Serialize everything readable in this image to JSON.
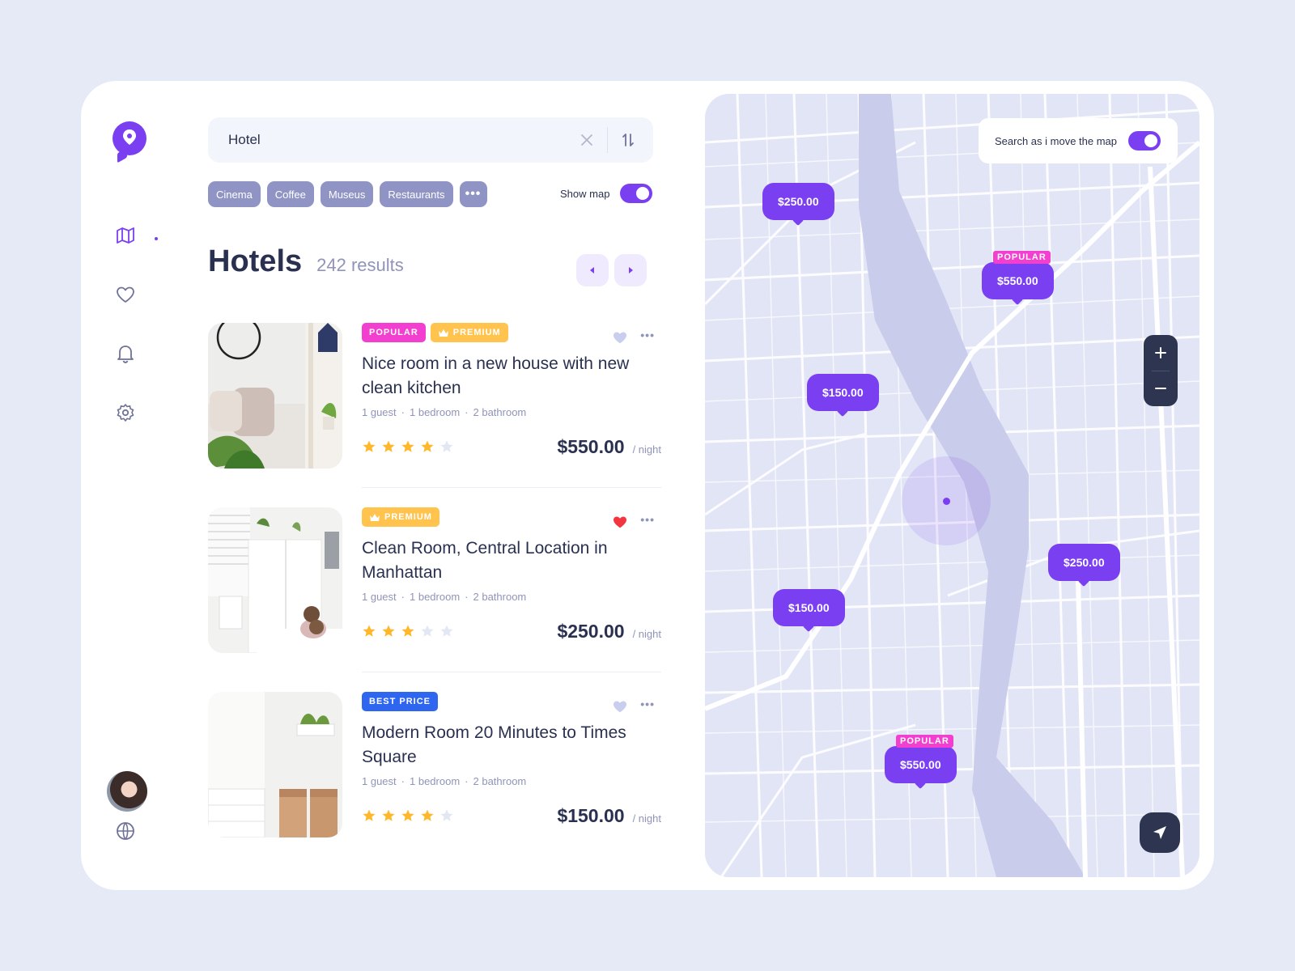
{
  "search": {
    "value": "Hotel",
    "placeholder": ""
  },
  "chips": [
    "Cinema",
    "Coffee",
    "Museus",
    "Restaurants",
    "•••"
  ],
  "show_map": {
    "label": "Show map",
    "on": true
  },
  "heading": {
    "title": "Hotels",
    "count": "242 results"
  },
  "listings": [
    {
      "badges": [
        "POPULAR",
        "PREMIUM"
      ],
      "title": "Nice room in a new house with new clean kitchen",
      "guests": "1 guest",
      "bedrooms": "1 bedroom",
      "bathrooms": "2 bathroom",
      "rating": 4,
      "price": "$550.00",
      "unit": "/ night",
      "favorite": false
    },
    {
      "badges": [
        "PREMIUM"
      ],
      "title": "Clean Room, Central Location in Manhattan",
      "guests": "1 guest",
      "bedrooms": "1 bedroom",
      "bathrooms": "2 bathroom",
      "rating": 3,
      "price": "$250.00",
      "unit": "/ night",
      "favorite": true
    },
    {
      "badges": [
        "BEST PRICE"
      ],
      "title": "Modern Room 20 Minutes to Times Square",
      "guests": "1 guest",
      "bedrooms": "1 bedroom",
      "bathrooms": "2 bathroom",
      "rating": 4,
      "price": "$150.00",
      "unit": "/ night",
      "favorite": false
    }
  ],
  "map": {
    "search_toggle": {
      "label": "Search as i move the map",
      "on": true
    },
    "pins": [
      {
        "price": "$250.00",
        "tag": ""
      },
      {
        "price": "$550.00",
        "tag": "POPULAR"
      },
      {
        "price": "$150.00",
        "tag": ""
      },
      {
        "price": "$250.00",
        "tag": ""
      },
      {
        "price": "$150.00",
        "tag": ""
      },
      {
        "price": "$550.00",
        "tag": "POPULAR"
      }
    ],
    "zoom_in": "+",
    "zoom_out": "−"
  },
  "colors": {
    "accent": "#7B3FF2",
    "popular": "#F33FD0",
    "premium": "#FFC34E",
    "best_price": "#2F66F0",
    "dark": "#2E3550",
    "background": "#E6EAF6"
  },
  "icons": {
    "logo": "location-pin-icon",
    "sidebar": [
      "map-icon",
      "heart-icon",
      "bell-icon",
      "gear-icon",
      "globe-icon"
    ]
  }
}
